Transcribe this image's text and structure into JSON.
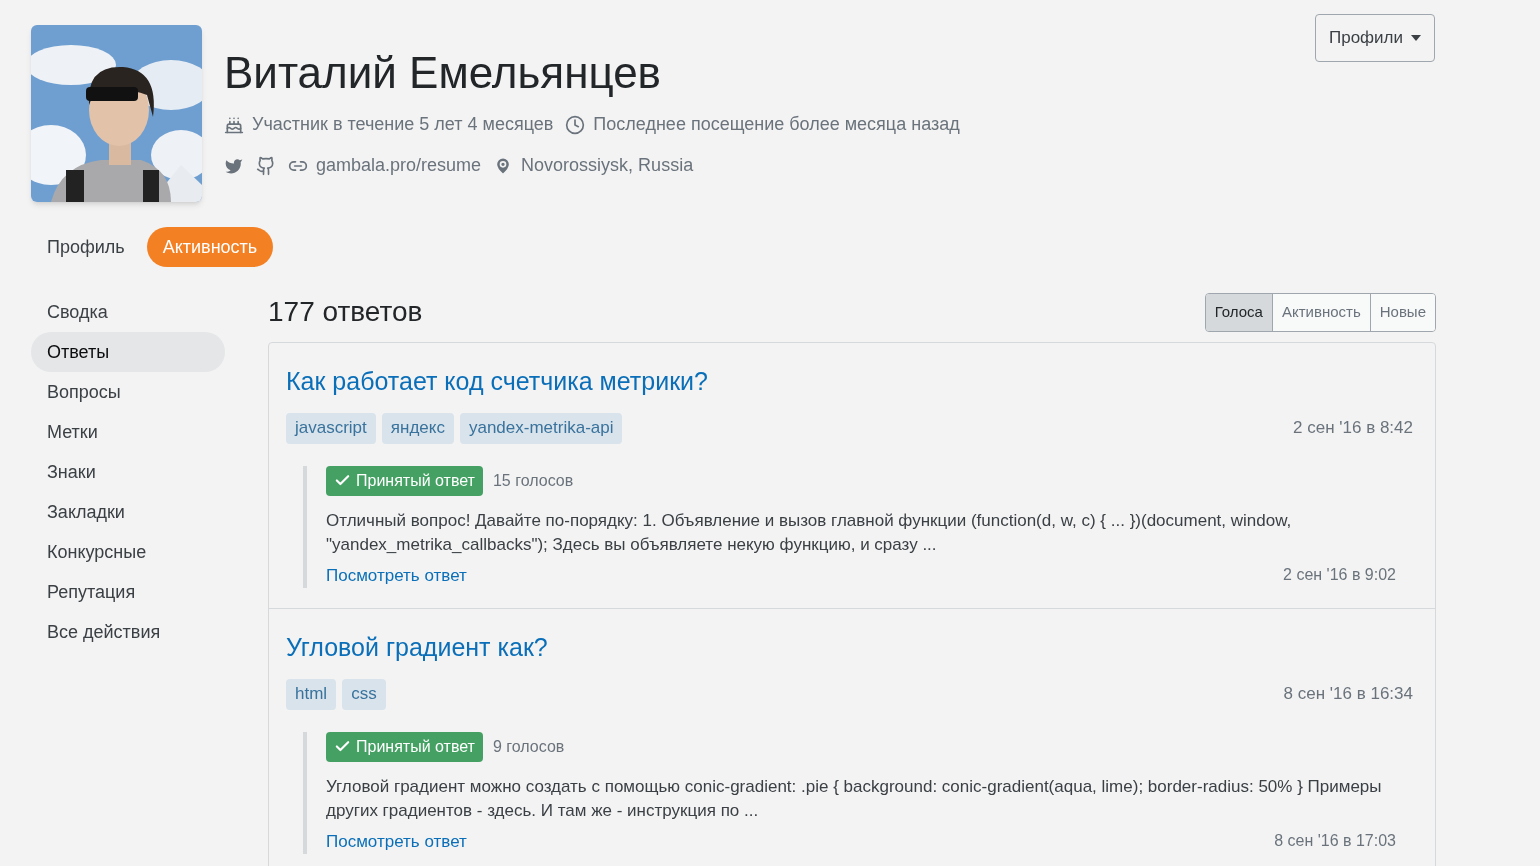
{
  "profile": {
    "name": "Виталий Емельянцев",
    "member_since": "Участник в течение 5 лет 4 месяцев",
    "last_seen": "Последнее посещение более месяца назад",
    "website": "gambala.pro/resume",
    "location": "Novorossiysk, Russia"
  },
  "profiles_button": {
    "label": "Профили"
  },
  "tabs": [
    {
      "label": "Профиль",
      "selected": false
    },
    {
      "label": "Активность",
      "selected": true
    }
  ],
  "sidebar": {
    "items": [
      {
        "label": "Сводка",
        "selected": false
      },
      {
        "label": "Ответы",
        "selected": true
      },
      {
        "label": "Вопросы",
        "selected": false
      },
      {
        "label": "Метки",
        "selected": false
      },
      {
        "label": "Знаки",
        "selected": false
      },
      {
        "label": "Закладки",
        "selected": false
      },
      {
        "label": "Конкурсные",
        "selected": false
      },
      {
        "label": "Репутация",
        "selected": false
      },
      {
        "label": "Все действия",
        "selected": false
      }
    ]
  },
  "answers": {
    "title": "177 ответов",
    "sort": [
      {
        "label": "Голоса",
        "selected": true
      },
      {
        "label": "Активность",
        "selected": false
      },
      {
        "label": "Новые",
        "selected": false
      }
    ],
    "items": [
      {
        "question": "Как работает код счетчика метрики?",
        "tags": [
          "javascript",
          "яндекс",
          "yandex-metrika-api"
        ],
        "asked": "2 сен '16 в 8:42",
        "accepted": true,
        "accepted_label": "Принятый ответ",
        "votes": "15 голосов",
        "excerpt": "Отличный вопрос! Давайте по-порядку: 1. Объявление и вызов главной функции (function(d, w, c) { ... })(document, window, \"yandex_metrika_callbacks\"); Здесь вы объявляете некую функцию, и сразу ...",
        "link": "Посмотреть ответ",
        "answered": "2 сен '16 в 9:02"
      },
      {
        "question": "Угловой градиент как?",
        "tags": [
          "html",
          "css"
        ],
        "asked": "8 сен '16 в 16:34",
        "accepted": true,
        "accepted_label": "Принятый ответ",
        "votes": "9 голосов",
        "excerpt": "Угловой градиент можно создать с помощью conic-gradient: .pie { background: conic-gradient(aqua, lime); border-radius: 50% } Примеры других градиентов - здесь. И там же - инструкция по ...",
        "link": "Посмотреть ответ",
        "answered": "8 сен '16 в 17:03"
      }
    ]
  }
}
